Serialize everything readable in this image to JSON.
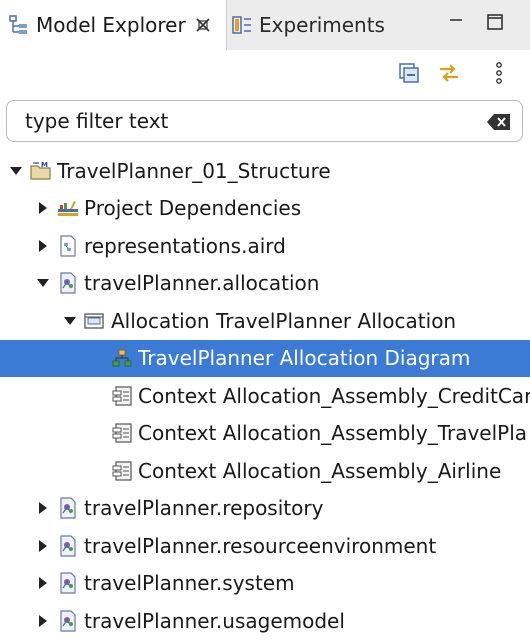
{
  "tabs": [
    {
      "label": "Model Explorer",
      "icon": "model-explorer-icon",
      "active": true
    },
    {
      "label": "Experiments",
      "icon": "experiments-icon",
      "active": false
    }
  ],
  "filter": {
    "placeholder": "type filter text",
    "value": ""
  },
  "tree": [
    {
      "label": "TravelPlanner_01_Structure",
      "level": 0,
      "state": "expanded",
      "icon": "project-folder-icon"
    },
    {
      "label": "Project Dependencies",
      "level": 1,
      "state": "collapsed",
      "icon": "library-icon"
    },
    {
      "label": "representations.aird",
      "level": 1,
      "state": "collapsed",
      "icon": "aird-file-icon"
    },
    {
      "label": "travelPlanner.allocation",
      "level": 1,
      "state": "expanded",
      "icon": "model-file-icon"
    },
    {
      "label": "Allocation TravelPlanner Allocation",
      "level": 2,
      "state": "expanded",
      "icon": "allocation-icon"
    },
    {
      "label": "TravelPlanner Allocation Diagram",
      "level": 3,
      "state": "leaf",
      "icon": "diagram-icon",
      "selected": true
    },
    {
      "label": "Context Allocation_Assembly_CreditCar",
      "level": 3,
      "state": "leaf",
      "icon": "context-icon"
    },
    {
      "label": "Context Allocation_Assembly_TravelPla",
      "level": 3,
      "state": "leaf",
      "icon": "context-icon"
    },
    {
      "label": "Context Allocation_Assembly_Airline",
      "level": 3,
      "state": "leaf",
      "icon": "context-icon"
    },
    {
      "label": "travelPlanner.repository",
      "level": 1,
      "state": "collapsed",
      "icon": "model-file-icon"
    },
    {
      "label": "travelPlanner.resourceenvironment",
      "level": 1,
      "state": "collapsed",
      "icon": "model-file-icon"
    },
    {
      "label": "travelPlanner.system",
      "level": 1,
      "state": "collapsed",
      "icon": "model-file-icon"
    },
    {
      "label": "travelPlanner.usagemodel",
      "level": 1,
      "state": "collapsed",
      "icon": "model-file-icon"
    }
  ],
  "colors": {
    "selection": "#3b7bd6",
    "tab_bar": "#ececec"
  }
}
